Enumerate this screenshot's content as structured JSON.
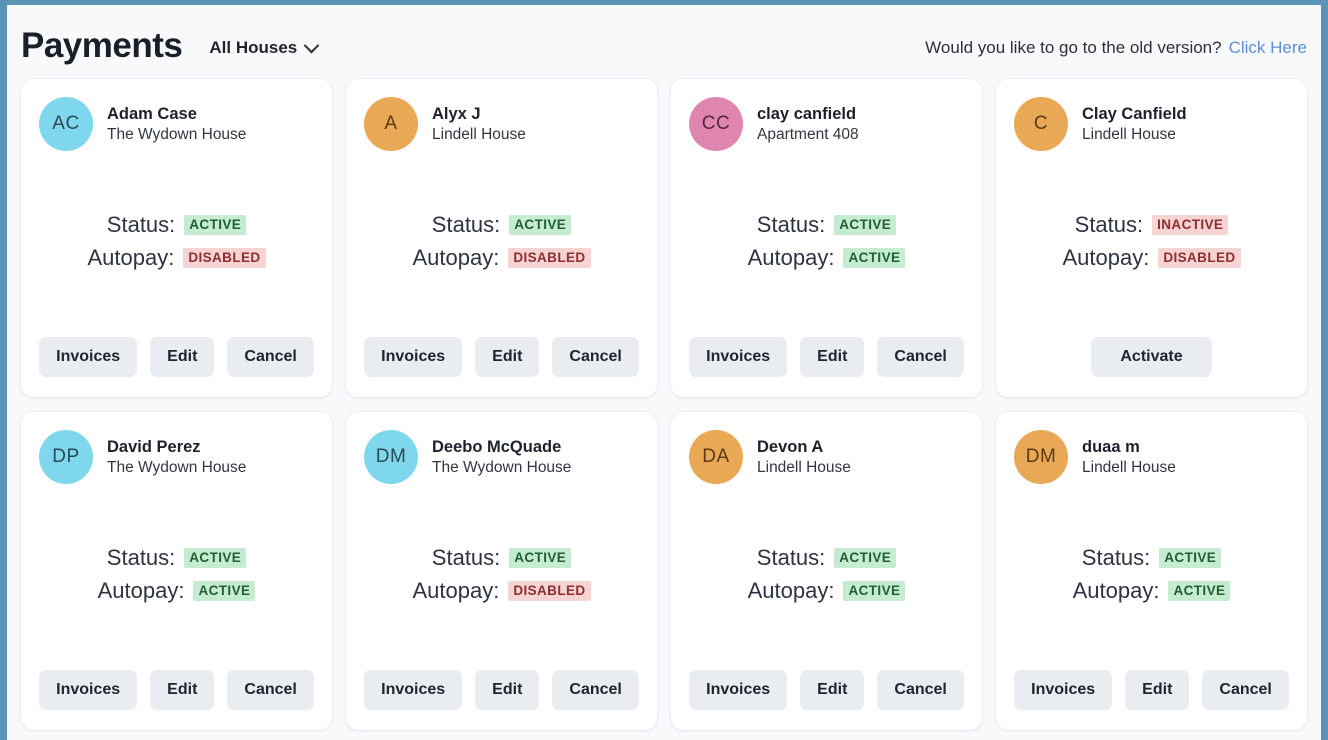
{
  "header": {
    "title": "Payments",
    "house_filter": {
      "label": "All Houses",
      "icon": "chevron-down-icon"
    },
    "old_version_prompt": "Would you like to go to the old version?",
    "old_version_link": "Click Here"
  },
  "labels": {
    "status": "Status:",
    "autopay": "Autopay:"
  },
  "colors": {
    "frame_border": "#5b93b5",
    "page_background": "#f7f9fb",
    "card_background": "#ffffff",
    "badge_active_bg": "#c5ecd0",
    "badge_active_text": "#1f5f33",
    "badge_negative_bg": "#f6d4d4",
    "badge_negative_text": "#8d2f2f",
    "button_bg": "#e9ecf1",
    "link": "#5d8fd6",
    "avatar_blue": "#7fd7ed",
    "avatar_orange": "#e8a855",
    "avatar_pink": "#e086ae"
  },
  "cards": [
    {
      "initials": "AC",
      "avatar_color": "#7fd7ed",
      "avatar_text_color": "#2c4a52",
      "name": "Adam Case",
      "house": "The Wydown House",
      "status": "ACTIVE",
      "status_type": "active",
      "autopay": "DISABLED",
      "autopay_type": "disabled",
      "buttons": [
        "Invoices",
        "Edit",
        "Cancel"
      ]
    },
    {
      "initials": "A",
      "avatar_color": "#e8a855",
      "avatar_text_color": "#5a3a14",
      "name": "Alyx J",
      "house": "Lindell House",
      "status": "ACTIVE",
      "status_type": "active",
      "autopay": "DISABLED",
      "autopay_type": "disabled",
      "buttons": [
        "Invoices",
        "Edit",
        "Cancel"
      ]
    },
    {
      "initials": "CC",
      "avatar_color": "#e086ae",
      "avatar_text_color": "#53244a",
      "name": "clay canfield",
      "house": "Apartment 408",
      "status": "ACTIVE",
      "status_type": "active",
      "autopay": "ACTIVE",
      "autopay_type": "active",
      "buttons": [
        "Invoices",
        "Edit",
        "Cancel"
      ]
    },
    {
      "initials": "C",
      "avatar_color": "#e8a855",
      "avatar_text_color": "#5a3a14",
      "name": "Clay Canfield",
      "house": "Lindell House",
      "status": "INACTIVE",
      "status_type": "inactive",
      "autopay": "DISABLED",
      "autopay_type": "disabled",
      "buttons": [
        "Activate"
      ]
    },
    {
      "initials": "DP",
      "avatar_color": "#7fd7ed",
      "avatar_text_color": "#2c4a52",
      "name": "David Perez",
      "house": "The Wydown House",
      "status": "ACTIVE",
      "status_type": "active",
      "autopay": "ACTIVE",
      "autopay_type": "active",
      "buttons": [
        "Invoices",
        "Edit",
        "Cancel"
      ]
    },
    {
      "initials": "DM",
      "avatar_color": "#7fd7ed",
      "avatar_text_color": "#2c4a52",
      "name": "Deebo McQuade",
      "house": "The Wydown House",
      "status": "ACTIVE",
      "status_type": "active",
      "autopay": "DISABLED",
      "autopay_type": "disabled",
      "buttons": [
        "Invoices",
        "Edit",
        "Cancel"
      ]
    },
    {
      "initials": "DA",
      "avatar_color": "#e8a855",
      "avatar_text_color": "#5a3a14",
      "name": "Devon A",
      "house": "Lindell House",
      "status": "ACTIVE",
      "status_type": "active",
      "autopay": "ACTIVE",
      "autopay_type": "active",
      "buttons": [
        "Invoices",
        "Edit",
        "Cancel"
      ]
    },
    {
      "initials": "DM",
      "avatar_color": "#e8a855",
      "avatar_text_color": "#5a3a14",
      "name": "duaa m",
      "house": "Lindell House",
      "status": "ACTIVE",
      "status_type": "active",
      "autopay": "ACTIVE",
      "autopay_type": "active",
      "buttons": [
        "Invoices",
        "Edit",
        "Cancel"
      ]
    }
  ]
}
